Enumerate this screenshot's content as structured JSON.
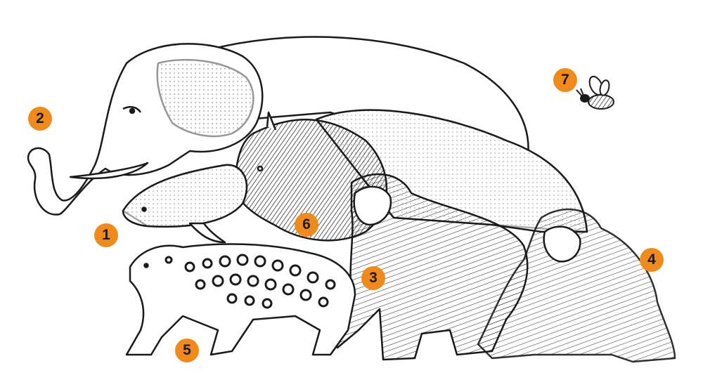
{
  "badge_color": "#F08A1A",
  "ink_color": "#1a1a1a",
  "animals": [
    {
      "number": "1",
      "subject": "porpoise"
    },
    {
      "number": "2",
      "subject": "elephant"
    },
    {
      "number": "3",
      "subject": "gorilla"
    },
    {
      "number": "4",
      "subject": "orangutan"
    },
    {
      "number": "5",
      "subject": "jaguar"
    },
    {
      "number": "6",
      "subject": "bison"
    },
    {
      "number": "7",
      "subject": "bee"
    }
  ]
}
